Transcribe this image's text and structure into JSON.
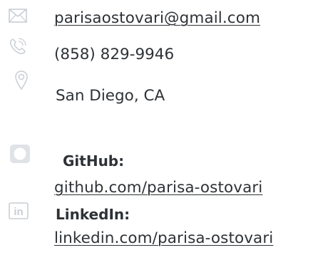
{
  "contact": {
    "email": "parisaostovari@gmail.com",
    "phone": "(858) 829-9946",
    "location": "San Diego, CA"
  },
  "profiles": {
    "github_label": "GitHub:",
    "github_link": "github.com/parisa-ostovari",
    "linkedin_label": "LinkedIn:",
    "linkedin_link": "linkedin.com/parisa-ostovari"
  },
  "icons": {
    "email": "envelope-icon",
    "phone": "phone-icon",
    "location": "map-pin-icon",
    "github": "github-icon",
    "linkedin": "linkedin-icon"
  },
  "colors": {
    "text": "#2e3236",
    "icon": "#c9cdd4"
  }
}
